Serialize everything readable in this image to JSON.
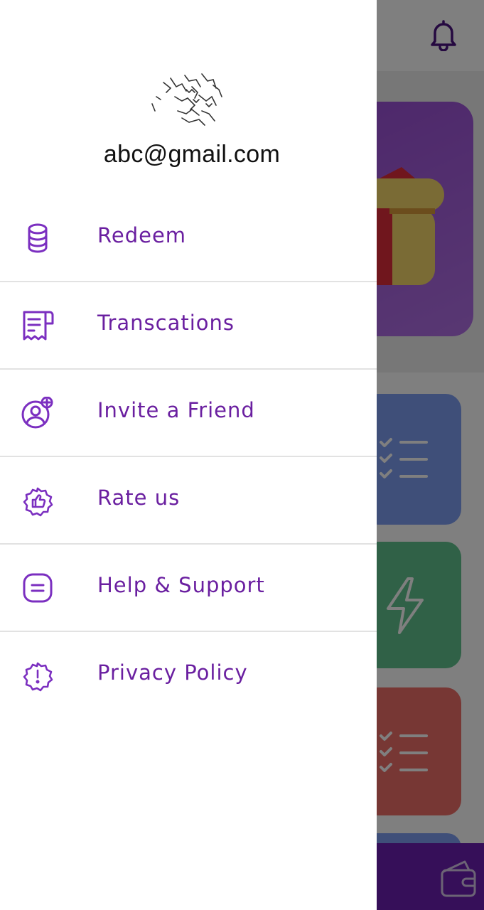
{
  "drawer": {
    "email": "abc@gmail.com",
    "menu": [
      {
        "label": "Redeem",
        "icon": "coins-stack-icon"
      },
      {
        "label": "Transcations",
        "icon": "receipt-icon"
      },
      {
        "label": "Invite a Friend",
        "icon": "add-user-icon"
      },
      {
        "label": "Rate us",
        "icon": "thumbs-up-badge-icon"
      },
      {
        "label": "Help & Support",
        "icon": "message-square-icon"
      },
      {
        "label": "Privacy Policy",
        "icon": "alert-badge-icon"
      }
    ]
  },
  "background_app": {
    "icons": [
      "bell-icon",
      "gift-icon",
      "checklist-icon",
      "lightning-icon",
      "checklist-icon",
      "wallet-icon"
    ]
  },
  "colors": {
    "accent": "#6a1fa0",
    "bottom_nav": "#6d1fb3",
    "hero_card": "#9b4fd6",
    "card_blue": "#7f9ff3",
    "card_green": "#61c28e",
    "card_red": "#ef6e68"
  }
}
